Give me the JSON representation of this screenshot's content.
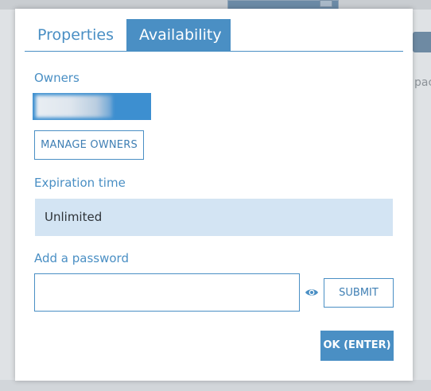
{
  "dialog": {
    "tabs": [
      {
        "label": "Properties",
        "active": false
      },
      {
        "label": "Availability",
        "active": true
      }
    ],
    "owners": {
      "label": "Owners",
      "manage_label": "MANAGE OWNERS"
    },
    "expiration": {
      "label": "Expiration time",
      "value": "Unlimited"
    },
    "password": {
      "label": "Add a password",
      "value": "",
      "toggle_icon": "eye-icon",
      "submit_label": "SUBMIT"
    },
    "ok_label": "OK (ENTER)"
  },
  "background": {
    "partial_text": "pac"
  },
  "colors": {
    "accent": "#4a8fc4",
    "select_bg": "#d3e4f3",
    "chip_bg": "#3d8fd0",
    "text": "#2e3338"
  }
}
